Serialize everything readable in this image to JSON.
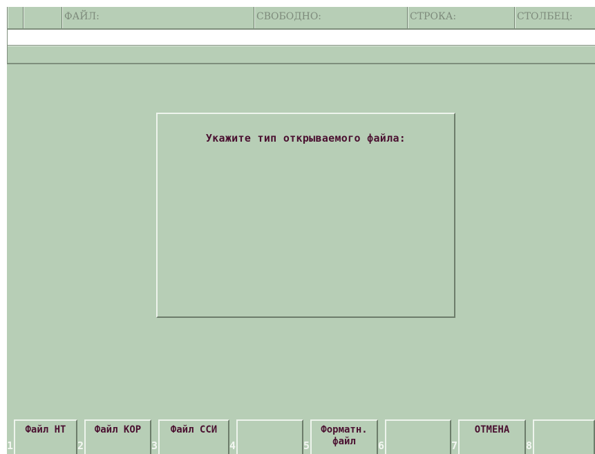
{
  "status_bar": {
    "file_label": "ФАЙЛ:",
    "free_label": "СВОБОДНО:",
    "row_label": "СТРОКА:",
    "column_label": "СТОЛБЕЦ:"
  },
  "dialog": {
    "title": "Укажите тип открываемого файла:"
  },
  "function_keys": [
    {
      "num": "1",
      "label": "Файл НТ"
    },
    {
      "num": "2",
      "label": "Файл КОР"
    },
    {
      "num": "3",
      "label": "Файл ССИ"
    },
    {
      "num": "4",
      "label": ""
    },
    {
      "num": "5",
      "label": "Форматн.\nфайл"
    },
    {
      "num": "6",
      "label": ""
    },
    {
      "num": "7",
      "label": "ОТМЕНА"
    },
    {
      "num": "8",
      "label": ""
    }
  ]
}
